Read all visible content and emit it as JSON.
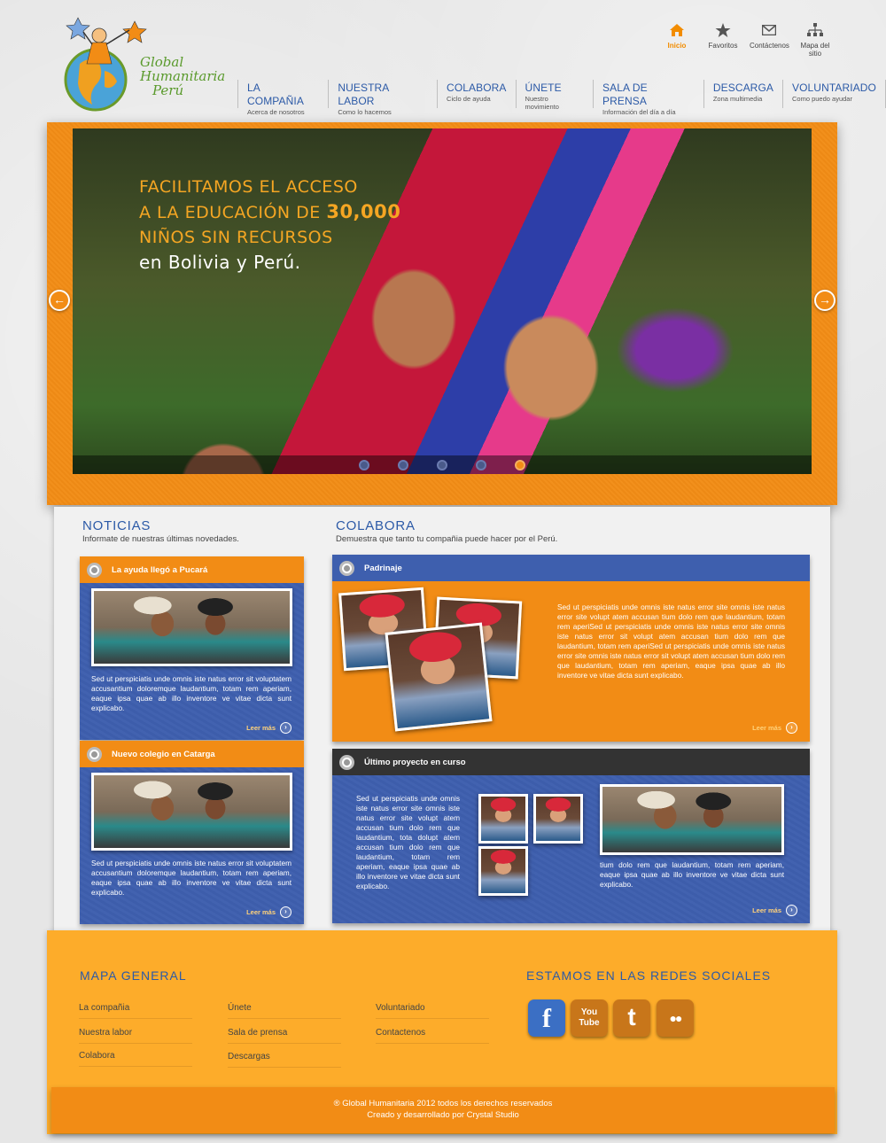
{
  "brand": {
    "line1": "Global",
    "line2": "Humanitaria",
    "line3": "Perú"
  },
  "util_nav": [
    {
      "label": "Inicio",
      "icon": "home-icon"
    },
    {
      "label": "Favoritos",
      "icon": "star-icon"
    },
    {
      "label": "Contáctenos",
      "icon": "mail-icon"
    },
    {
      "label": "Mapa del sitio",
      "icon": "sitemap-icon"
    }
  ],
  "main_nav": [
    {
      "title": "LA COMPAÑIA",
      "sub": "Acerca de nosotros"
    },
    {
      "title": "NUESTRA LABOR",
      "sub": "Como lo hacemos"
    },
    {
      "title": "COLABORA",
      "sub": "Ciclo de ayuda"
    },
    {
      "title": "ÚNETE",
      "sub": "Nuestro movimiento"
    },
    {
      "title": "SALA DE PRENSA",
      "sub": "Información del día a día"
    },
    {
      "title": "DESCARGA",
      "sub": "Zona multimedia"
    },
    {
      "title": "VOLUNTARIADO",
      "sub": "Como puedo ayudar"
    }
  ],
  "hero": {
    "line1": "FACILITAMOS EL ACCESO",
    "line2_pre": "A LA EDUCACIÓN DE ",
    "line2_num": "30,000",
    "line3": "NIÑOS SIN RECURSOS",
    "line4": "en Bolivia y Perú.",
    "prev": "←",
    "next": "→"
  },
  "noticias": {
    "title": "NOTICIAS",
    "subtitle": "Informate de nuestras últimas novedades.",
    "items": [
      {
        "heading": "La ayuda llegó a Pucará",
        "text": "Sed ut perspiciatis unde omnis iste natus error sit voluptatem accusantium doloremque laudantium, totam rem aperiam, eaque ipsa quae ab illo inventore ve vitae dicta sunt explicabo.",
        "more": "Leer más"
      },
      {
        "heading": "Nuevo colegio en Catarga",
        "text": "Sed ut perspiciatis unde omnis iste natus error sit voluptatem accusantium doloremque laudantium, totam rem aperiam, eaque ipsa quae ab illo inventore ve vitae dicta sunt explicabo.",
        "more": "Leer más"
      }
    ]
  },
  "colabora": {
    "title": "COLABORA",
    "subtitle": "Demuestra que tanto tu compañia puede hacer por el Perú.",
    "padrinaje": {
      "heading": "Padrinaje",
      "text": "Sed ut perspiciatis unde omnis iste natus error site omnis iste natus error site volupt atem accusan tium dolo rem que laudantium, totam rem aperiSed ut perspiciatis unde omnis iste natus error site omnis iste natus error sit volupt atem accusan tium dolo rem que laudantium, totam rem aperiSed ut perspiciatis unde omnis iste natus error site omnis iste natus error sit volupt atem accusan tium dolo rem que laudantium, totam rem aperiam, eaque ipsa quae ab illo inventore ve vitae dicta sunt explicabo.",
      "more": "Leer más"
    },
    "proyecto": {
      "heading": "Último proyecto en curso",
      "text_left": "Sed ut perspiciatis unde omnis iste natus error site omnis iste natus error site volupt atem accusan tium dolo rem que laudantium, tota dolupt atem accusan tium dolo rem que laudantium, totam rem aperiam, eaque ipsa quae ab illo inventore ve vitae dicta sunt explicabo.",
      "text_right": "tium dolo rem que laudantium, totam rem aperiam, eaque ipsa quae ab illo inventore ve vitae dicta sunt explicabo.",
      "more": "Leer más"
    }
  },
  "footer": {
    "map_title": "MAPA GENERAL",
    "links": [
      "La compañia",
      "Nuestra labor",
      "Colabora",
      "Únete",
      "Sala de prensa",
      "Descargas",
      "Voluntariado",
      "Contactenos"
    ],
    "social_title": "ESTAMOS EN LAS REDES SOCIALES",
    "social": [
      {
        "label": "f",
        "icon": "facebook-icon",
        "color": "#3b6fc4"
      },
      {
        "label": "You Tube",
        "icon": "youtube-icon",
        "color": "#c8761a"
      },
      {
        "label": "t",
        "icon": "twitter-icon",
        "color": "#c8761a"
      },
      {
        "label": "●●",
        "icon": "flickr-icon",
        "color": "#c8761a"
      }
    ],
    "copyright": "® Global Humanitaria 2012 todos los derechos reservados",
    "credit": "Creado y desarrollado por Crystal Studio"
  }
}
